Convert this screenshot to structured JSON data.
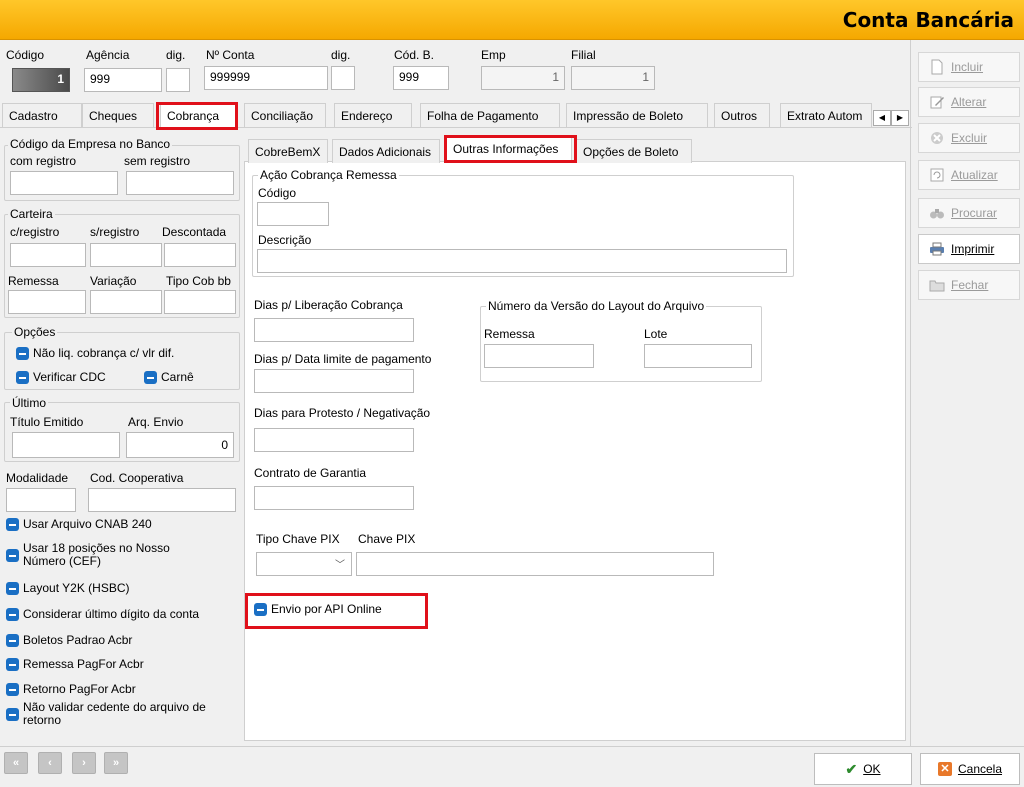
{
  "window": {
    "title": "Conta Bancária"
  },
  "header": {
    "codigo_label": "Código",
    "codigo_value": "1",
    "agencia_label": "Agência",
    "agencia_value": "999",
    "dig1_label": "dig.",
    "dig1_value": "",
    "conta_label": "Nº Conta",
    "conta_value": "999999",
    "dig2_label": "dig.",
    "dig2_value": "",
    "codb_label": "Cód. B.",
    "codb_value": "999",
    "emp_label": "Emp",
    "emp_value": "1",
    "filial_label": "Filial",
    "filial_value": "1"
  },
  "main_tabs": [
    "Cadastro",
    "Cheques",
    "Cobrança",
    "Conciliação",
    "Endereço",
    "Folha de Pagamento",
    "Impressão de Boleto",
    "Outros",
    "Extrato Autom"
  ],
  "left": {
    "empresa_group": "Código da Empresa no Banco",
    "com_registro": "com registro",
    "sem_registro": "sem registro",
    "carteira_group": "Carteira",
    "c_registro": "c/registro",
    "s_registro": "s/registro",
    "descontada": "Descontada",
    "remessa": "Remessa",
    "variacao": "Variação",
    "tipo_cob": "Tipo Cob bb",
    "opcoes_group": "Opções",
    "nao_liq": "Não liq. cobrança c/ vlr dif.",
    "verificar_cdc": "Verificar CDC",
    "carne": "Carnê",
    "ultimo_group": "Último",
    "titulo_emitido": "Título Emitido",
    "arq_envio": "Arq. Envio",
    "arq_envio_value": "0",
    "modalidade": "Modalidade",
    "cod_cooperativa": "Cod. Cooperativa",
    "checks": [
      "Usar Arquivo CNAB 240",
      "Usar 18 posições no Nosso Número (CEF)",
      "Layout Y2K (HSBC)",
      "Considerar último dígito da conta",
      "Boletos Padrao Acbr",
      "Remessa PagFor Acbr",
      "Retorno PagFor Acbr",
      "Não validar cedente do arquivo de retorno"
    ]
  },
  "sub_tabs": [
    "CobreBemX",
    "Dados Adicionais",
    "Outras Informações",
    "Opções de Boleto"
  ],
  "right": {
    "acao_group": "Ação Cobrança Remessa",
    "codigo": "Código",
    "descricao": "Descrição",
    "dias_liberacao": "Dias p/ Liberação Cobrança",
    "dias_limite": "Dias p/ Data limite de pagamento",
    "dias_protesto": "Dias para Protesto / Negativação",
    "contrato": "Contrato de Garantia",
    "versao_group": "Número da Versão do Layout do Arquivo",
    "remessa": "Remessa",
    "lote": "Lote",
    "tipo_chave_pix": "Tipo Chave PIX",
    "chave_pix": "Chave PIX",
    "envio_api": "Envio por API Online"
  },
  "side_buttons": [
    {
      "label": "Incluir",
      "icon": "document-icon",
      "enabled": false
    },
    {
      "label": "Alterar",
      "icon": "edit-icon",
      "enabled": false
    },
    {
      "label": "Excluir",
      "icon": "delete-icon",
      "enabled": false
    },
    {
      "label": "Atualizar",
      "icon": "refresh-icon",
      "enabled": false
    },
    {
      "label": "Procurar",
      "icon": "binoculars-icon",
      "enabled": false
    },
    {
      "label": "Imprimir",
      "icon": "printer-icon",
      "enabled": true
    },
    {
      "label": "Fechar",
      "icon": "close-folder-icon",
      "enabled": false
    }
  ],
  "footer": {
    "ok": "OK",
    "cancela": "Cancela"
  },
  "colors": {
    "title_bar": "#f5a800",
    "highlight": "#e0101a",
    "checkbox": "#1a6fc4"
  }
}
